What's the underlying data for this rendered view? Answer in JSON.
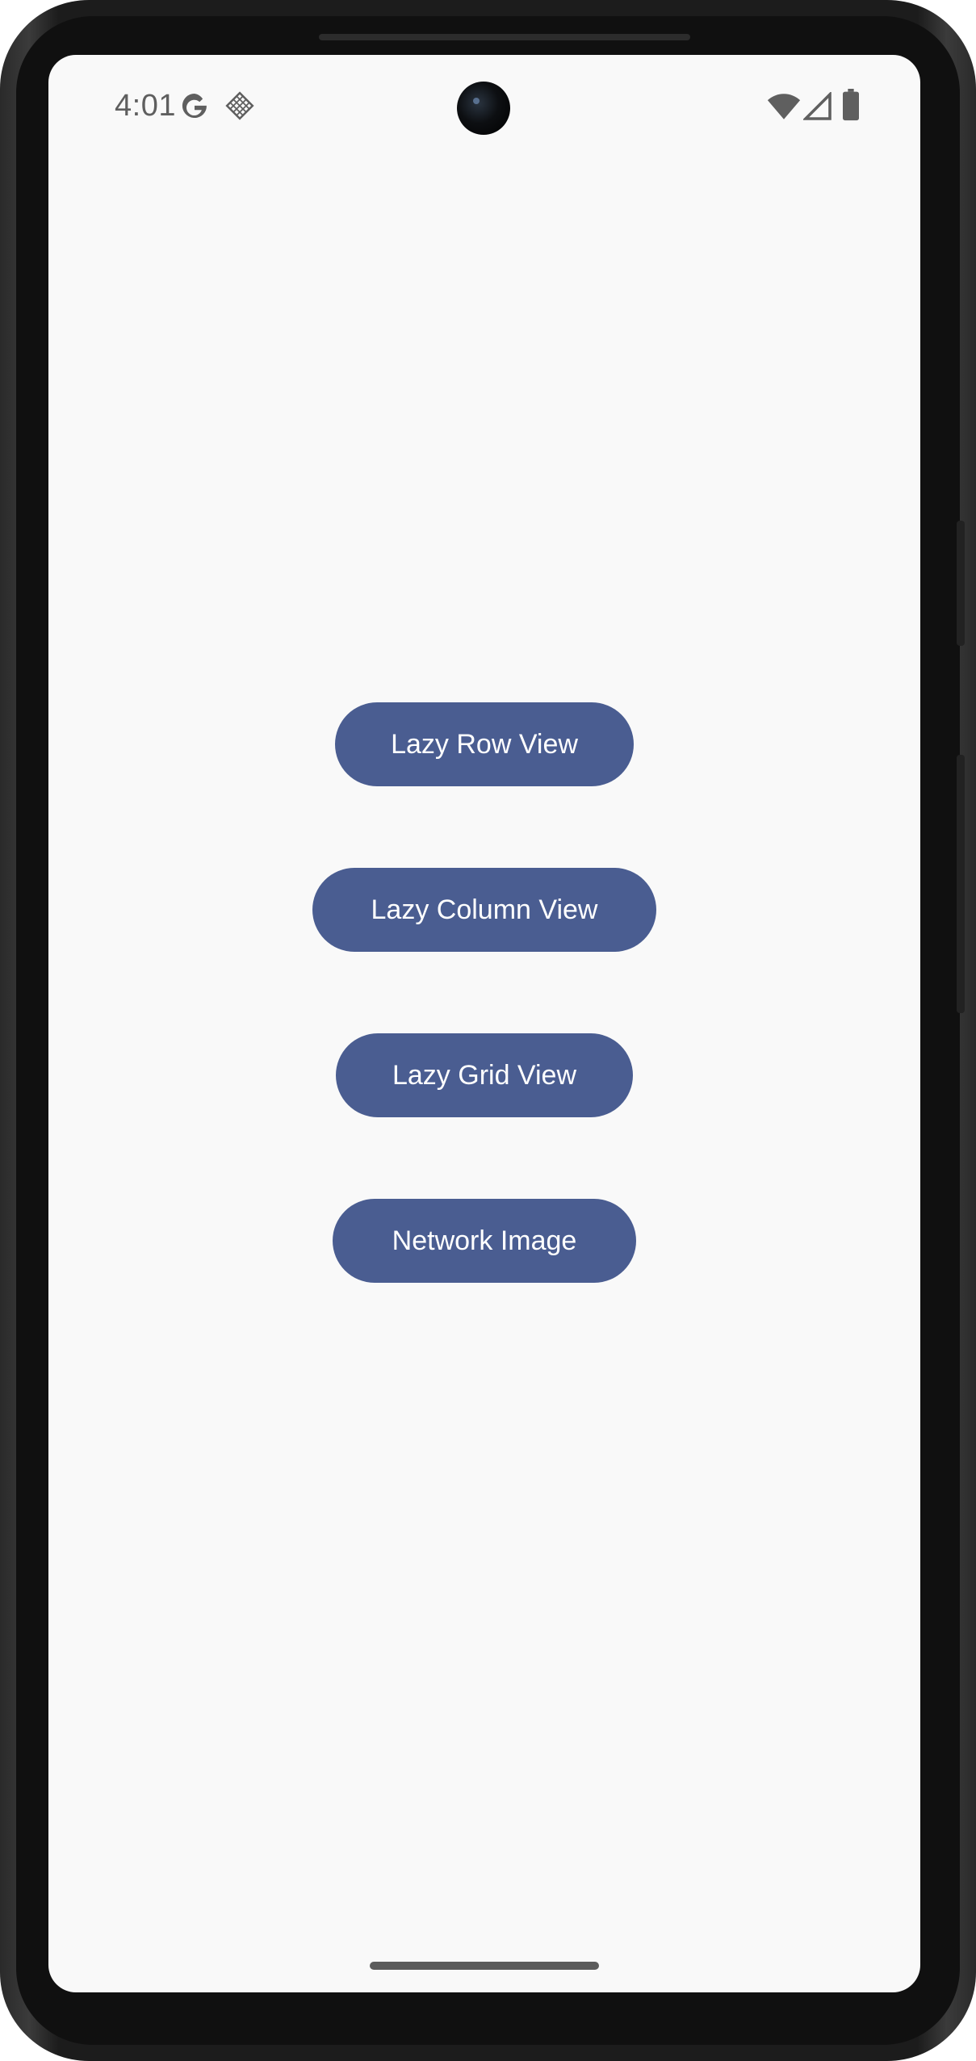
{
  "status_bar": {
    "time": "4:01",
    "icons": [
      "google-g-icon",
      "diamond-grid-icon",
      "wifi-icon",
      "cellular-signal-icon",
      "battery-icon"
    ]
  },
  "main": {
    "buttons": [
      {
        "label": "Lazy Row View"
      },
      {
        "label": "Lazy Column View"
      },
      {
        "label": "Lazy Grid View"
      },
      {
        "label": "Network Image"
      }
    ]
  },
  "colors": {
    "button_bg": "#4a5d91",
    "button_text": "#ffffff",
    "screen_bg": "#f9f9f9",
    "status_icon": "#5f5f5f"
  }
}
